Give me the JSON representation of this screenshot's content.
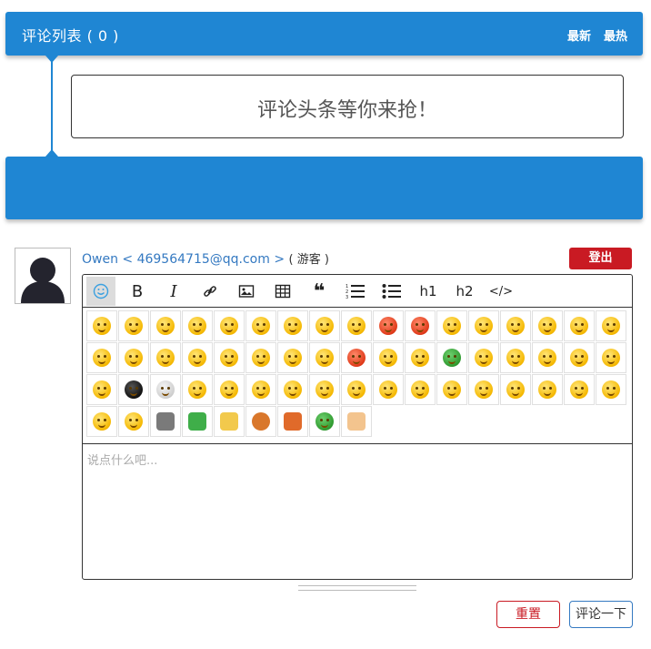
{
  "header": {
    "title": "评论列表 ( 0 )",
    "sort_newest": "最新",
    "sort_hottest": "最热"
  },
  "empty_message": "评论头条等你来抢！",
  "user": {
    "name_email": "Owen < 469564715@qq.com >",
    "role": "( 游客 )",
    "logout_label": "登出"
  },
  "toolbar": {
    "bold": "B",
    "italic": "I",
    "quote": "❝",
    "h1": "h1",
    "h2": "h2",
    "code": "</>"
  },
  "editor": {
    "placeholder": "说点什么吧..."
  },
  "actions": {
    "reset_label": "重置",
    "submit_label": "评论一下"
  },
  "emojis": [
    "smile",
    "smirk",
    "heart-eyes",
    "kiss",
    "cool",
    "surprised",
    "shy",
    "cry",
    "sob",
    "angry-red",
    "rage",
    "tongue",
    "grin",
    "worried",
    "sad",
    "sunglasses-mad",
    "dizzy",
    "laugh-cry",
    "sweat",
    "think",
    "blush",
    "shocked",
    "puzzled",
    "awkward",
    "speechless",
    "furious",
    "wink",
    "beam",
    "turtle",
    "headband",
    "frown",
    "confused",
    "shush",
    "spiral-eyes",
    "tearful",
    "black-monster",
    "skull",
    "peek",
    "hmm",
    "facepalm",
    "teehee",
    "yawn",
    "fist",
    "grin-big",
    "moon",
    "wave-hand",
    "strong",
    "annoyed",
    "lazy",
    "smug",
    "whistle",
    "shock-spike",
    "ghost",
    "kitchen-knife",
    "watermelon",
    "popcorn",
    "basketball",
    "coffee",
    "green-man",
    "handshake"
  ],
  "colors": {
    "accent_blue": "#1f86d3",
    "danger_red": "#c91a23",
    "link_blue": "#3479c1"
  }
}
